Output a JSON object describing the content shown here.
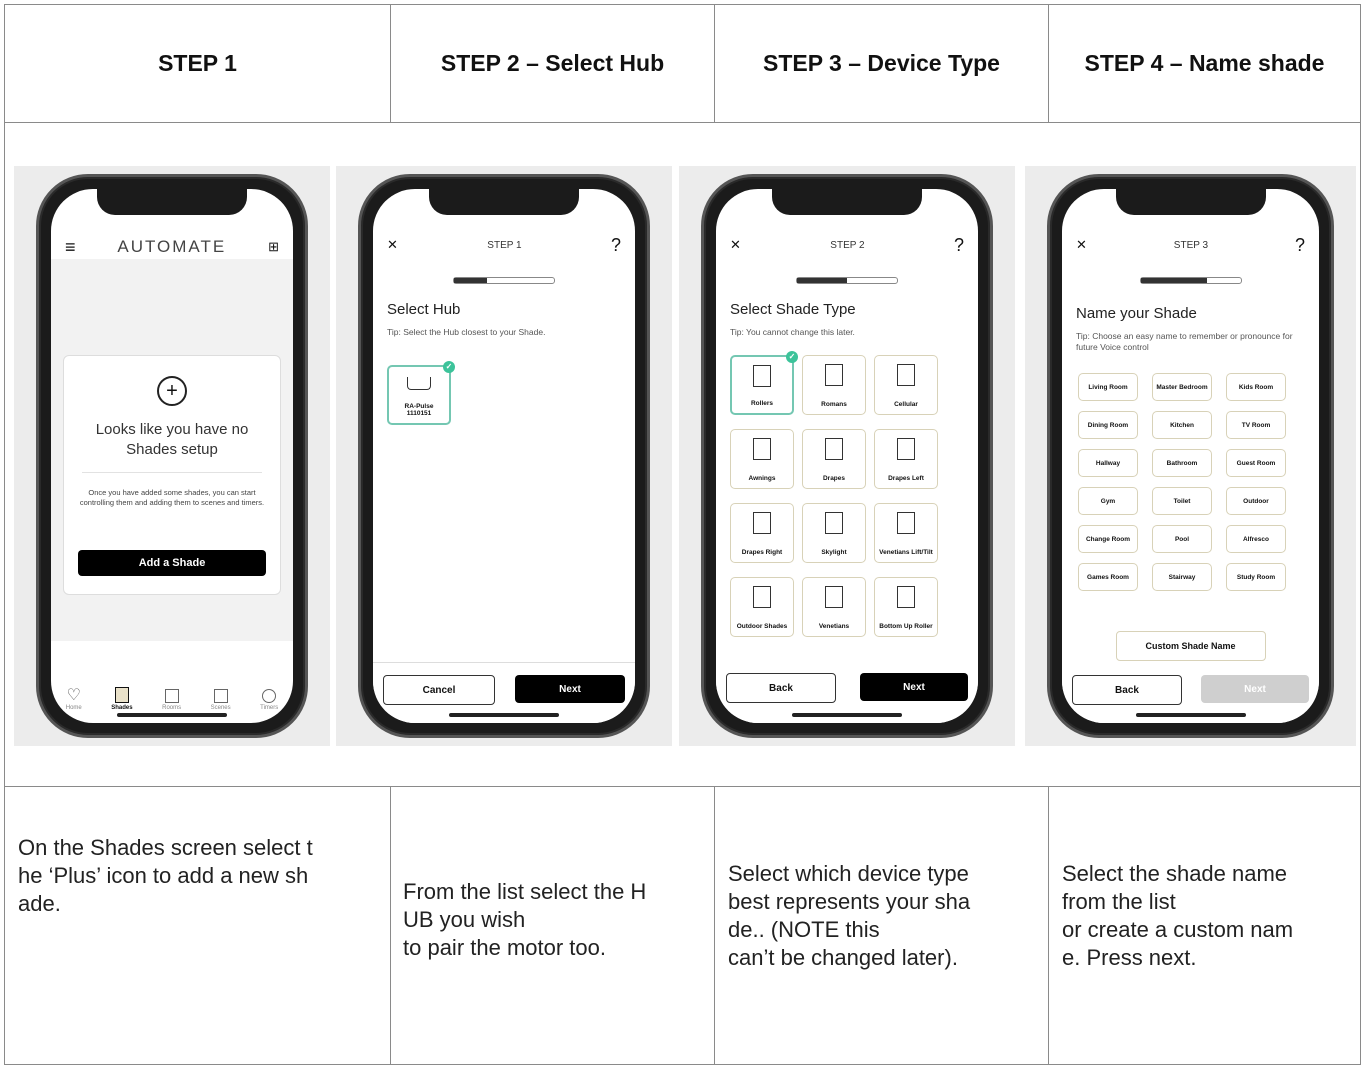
{
  "headers": [
    "STEP 1",
    "STEP 2 – Select Hub",
    "STEP 3 – Device Type",
    "STEP 4 – Name shade"
  ],
  "descriptions": [
    [
      "On the Shades screen select t",
      "he ‘Plus’ icon to add a new sh",
      "ade."
    ],
    [
      "From the list select the H",
      "UB you wish",
      "to pair the motor too."
    ],
    [
      "Select which device type",
      "best represents your sha",
      "de.. (NOTE this",
      "can’t be changed later)."
    ],
    [
      "Select the shade name",
      "from the list",
      "or create a custom nam",
      "e. Press next."
    ]
  ],
  "screen1": {
    "logo": "AUTOMATE",
    "empty_title": "Looks like you have no Shades setup",
    "empty_body": "Once you have added some shades, you can start controlling them and adding them to scenes and timers.",
    "add_button": "Add a Shade",
    "nav": [
      "Home",
      "Shades",
      "Rooms",
      "Scenes",
      "Timers"
    ],
    "active_nav": "Shades"
  },
  "screen2": {
    "step": "STEP 1",
    "progress": 0.33,
    "title": "Select Hub",
    "tip": "Tip: Select the Hub closest to your Shade.",
    "hub_label": "RA-Pulse\n1110151",
    "cancel": "Cancel",
    "next": "Next"
  },
  "screen3": {
    "step": "STEP 2",
    "progress": 0.5,
    "title": "Select Shade Type",
    "tip": "Tip: You cannot change this later.",
    "types": [
      "Rollers",
      "Romans",
      "Cellular",
      "Awnings",
      "Drapes",
      "Drapes Left",
      "Drapes Right",
      "Skylight",
      "Venetians Lift/Tilt",
      "Outdoor Shades",
      "Venetians",
      "Bottom Up Roller"
    ],
    "selected": "Rollers",
    "back": "Back",
    "next": "Next"
  },
  "screen4": {
    "step": "STEP 3",
    "progress": 0.66,
    "title": "Name your Shade",
    "tip": "Tip: Choose an easy name to remember or pronounce for future Voice control",
    "names": [
      "Living Room",
      "Master Bedroom",
      "Kids Room",
      "Dining Room",
      "Kitchen",
      "TV Room",
      "Hallway",
      "Bathroom",
      "Guest Room",
      "Gym",
      "Toilet",
      "Outdoor",
      "Change Room",
      "Pool",
      "Alfresco",
      "Games Room",
      "Stairway",
      "Study Room"
    ],
    "custom": "Custom Shade Name",
    "back": "Back",
    "next": "Next"
  }
}
